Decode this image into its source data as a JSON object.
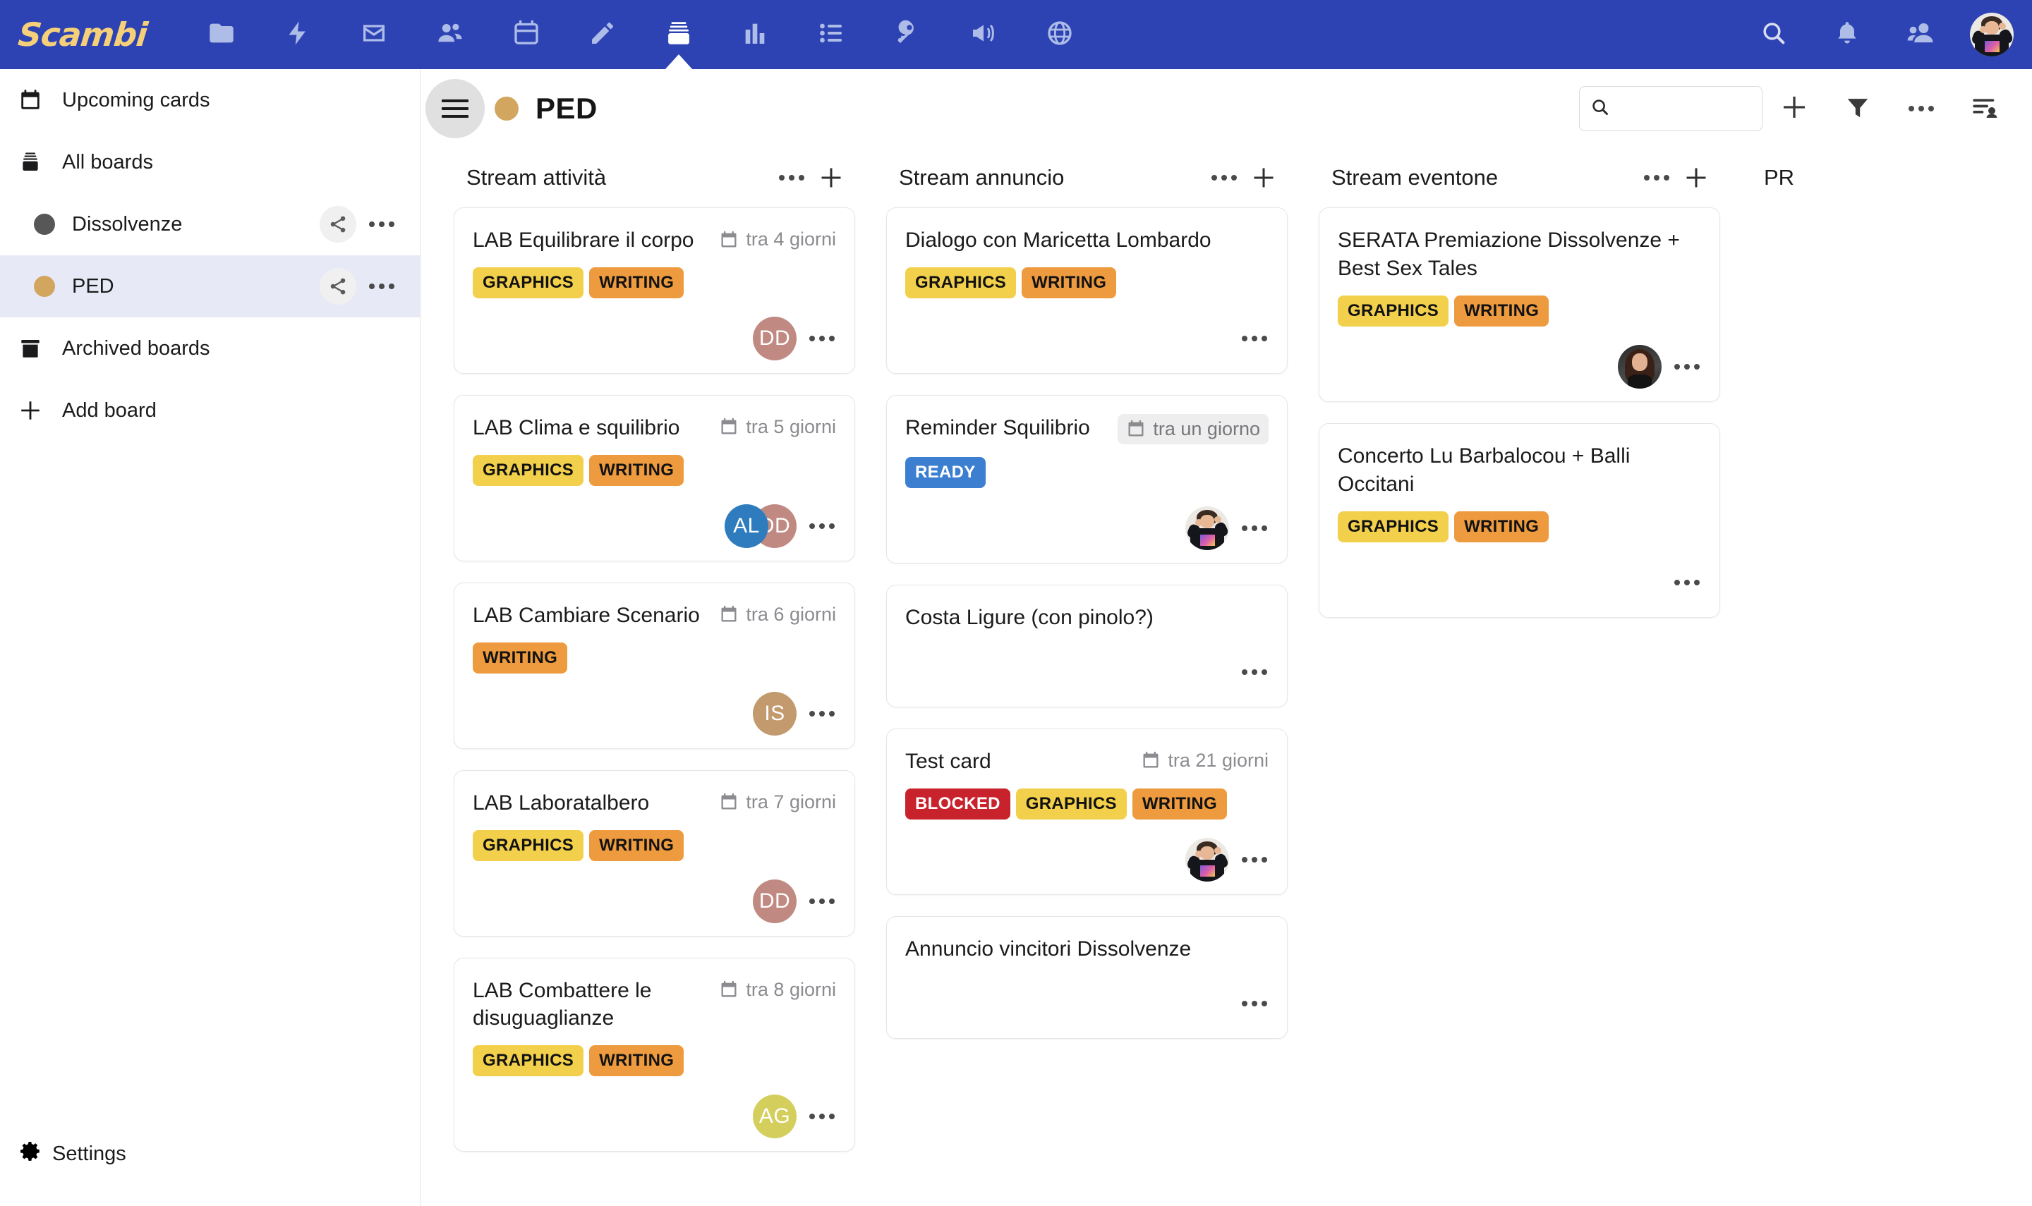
{
  "app": {
    "logo_text": "Scambi",
    "nav_items": [
      {
        "icon": "folder-icon",
        "name": "nav-folder"
      },
      {
        "icon": "lightning-icon",
        "name": "nav-activity"
      },
      {
        "icon": "envelope-icon",
        "name": "nav-mail"
      },
      {
        "icon": "people-icon",
        "name": "nav-contacts"
      },
      {
        "icon": "calendar-icon",
        "name": "nav-calendar"
      },
      {
        "icon": "pencil-icon",
        "name": "nav-notes"
      },
      {
        "icon": "board-stack-icon",
        "name": "nav-boards",
        "active": true
      },
      {
        "icon": "bar-chart-icon",
        "name": "nav-reports"
      },
      {
        "icon": "list-icon",
        "name": "nav-tasks"
      },
      {
        "icon": "key-icon",
        "name": "nav-passwords"
      },
      {
        "icon": "megaphone-icon",
        "name": "nav-announcements"
      },
      {
        "icon": "globe-icon",
        "name": "nav-web"
      }
    ],
    "nav_right": [
      {
        "icon": "search-icon",
        "name": "global-search"
      },
      {
        "icon": "bell-icon",
        "name": "notifications"
      },
      {
        "icon": "contacts-icon",
        "name": "user-directory"
      }
    ]
  },
  "sidebar": {
    "upcoming_label": "Upcoming cards",
    "all_boards_label": "All boards",
    "boards": [
      {
        "label": "Dissolvenze",
        "color": "#565756",
        "selected": false
      },
      {
        "label": "PED",
        "color": "#D2A65E",
        "selected": true
      }
    ],
    "archived_label": "Archived boards",
    "add_board_label": "Add board",
    "settings_label": "Settings"
  },
  "board": {
    "title": "PED",
    "color": "#D2A65E",
    "search_value": "",
    "search_placeholder": ""
  },
  "columns": [
    {
      "title": "Stream attività",
      "cards": [
        {
          "title": "LAB Equilibrare il corpo",
          "due": "tra 4 giorni",
          "due_soon": false,
          "labels": [
            {
              "text": "GRAPHICS",
              "bg": "#F2D04B",
              "fg": "#121212"
            },
            {
              "text": "WRITING",
              "bg": "#EE9B3F",
              "fg": "#121212"
            }
          ],
          "avatars": [
            {
              "type": "initials",
              "text": "DD",
              "bg": "#C08A82"
            }
          ]
        },
        {
          "title": "LAB Clima e squilibrio",
          "due": "tra 5 giorni",
          "due_soon": false,
          "labels": [
            {
              "text": "GRAPHICS",
              "bg": "#F2D04B",
              "fg": "#121212"
            },
            {
              "text": "WRITING",
              "bg": "#EE9B3F",
              "fg": "#121212"
            }
          ],
          "avatars": [
            {
              "type": "initials",
              "text": "AL",
              "bg": "#2E7CBE"
            },
            {
              "type": "initials",
              "text": "DD",
              "bg": "#C08A82"
            }
          ]
        },
        {
          "title": "LAB Cambiare Scenario",
          "due": "tra 6 giorni",
          "due_soon": false,
          "labels": [
            {
              "text": "WRITING",
              "bg": "#EE9B3F",
              "fg": "#121212"
            }
          ],
          "avatars": [
            {
              "type": "initials",
              "text": "IS",
              "bg": "#C29A6E"
            }
          ]
        },
        {
          "title": "LAB Laboratalbero",
          "due": "tra 7 giorni",
          "due_soon": false,
          "labels": [
            {
              "text": "GRAPHICS",
              "bg": "#F2D04B",
              "fg": "#121212"
            },
            {
              "text": "WRITING",
              "bg": "#EE9B3F",
              "fg": "#121212"
            }
          ],
          "avatars": [
            {
              "type": "initials",
              "text": "DD",
              "bg": "#C08A82"
            }
          ]
        },
        {
          "title": "LAB Combattere le disuguaglianze",
          "due": "tra 8 giorni",
          "due_soon": false,
          "labels": [
            {
              "text": "GRAPHICS",
              "bg": "#F2D04B",
              "fg": "#121212"
            },
            {
              "text": "WRITING",
              "bg": "#EE9B3F",
              "fg": "#121212"
            }
          ],
          "avatars": [
            {
              "type": "initials",
              "text": "AG",
              "bg": "#D4CF5C"
            }
          ]
        }
      ]
    },
    {
      "title": "Stream annuncio",
      "cards": [
        {
          "title": "Dialogo con Maricetta Lombardo",
          "due": "",
          "due_soon": false,
          "labels": [
            {
              "text": "GRAPHICS",
              "bg": "#F2D04B",
              "fg": "#121212"
            },
            {
              "text": "WRITING",
              "bg": "#EE9B3F",
              "fg": "#121212"
            }
          ],
          "avatars": []
        },
        {
          "title": "Reminder Squilibrio",
          "due": "tra un giorno",
          "due_soon": true,
          "labels": [
            {
              "text": "READY",
              "bg": "#3C7FD0",
              "fg": "#ffffff"
            }
          ],
          "avatars": [
            {
              "type": "photo",
              "variant": "A"
            }
          ]
        },
        {
          "title": "Costa Ligure (con pinolo?)",
          "due": "",
          "due_soon": false,
          "labels": [],
          "avatars": []
        },
        {
          "title": "Test card",
          "due": "tra 21 giorni",
          "due_soon": false,
          "labels": [
            {
              "text": "BLOCKED",
              "bg": "#C8232C",
              "fg": "#ffffff"
            },
            {
              "text": "GRAPHICS",
              "bg": "#F2D04B",
              "fg": "#121212"
            },
            {
              "text": "WRITING",
              "bg": "#EE9B3F",
              "fg": "#121212"
            }
          ],
          "avatars": [
            {
              "type": "photo",
              "variant": "A"
            }
          ]
        },
        {
          "title": "Annuncio vincitori Dissolvenze",
          "due": "",
          "due_soon": false,
          "labels": [],
          "avatars": []
        }
      ]
    },
    {
      "title": "Stream eventone",
      "cards": [
        {
          "title": "SERATA Premiazione Dissolvenze + Best Sex Tales",
          "due": "",
          "due_soon": false,
          "labels": [
            {
              "text": "GRAPHICS",
              "bg": "#F2D04B",
              "fg": "#121212"
            },
            {
              "text": "WRITING",
              "bg": "#EE9B3F",
              "fg": "#121212"
            }
          ],
          "avatars": [
            {
              "type": "photo",
              "variant": "B"
            }
          ]
        },
        {
          "title": "Concerto Lu Barbalocou + Balli Occitani",
          "due": "",
          "due_soon": false,
          "labels": [
            {
              "text": "GRAPHICS",
              "bg": "#F2D04B",
              "fg": "#121212"
            },
            {
              "text": "WRITING",
              "bg": "#EE9B3F",
              "fg": "#121212"
            }
          ],
          "avatars": []
        }
      ]
    },
    {
      "title": "PR",
      "cards": []
    }
  ]
}
